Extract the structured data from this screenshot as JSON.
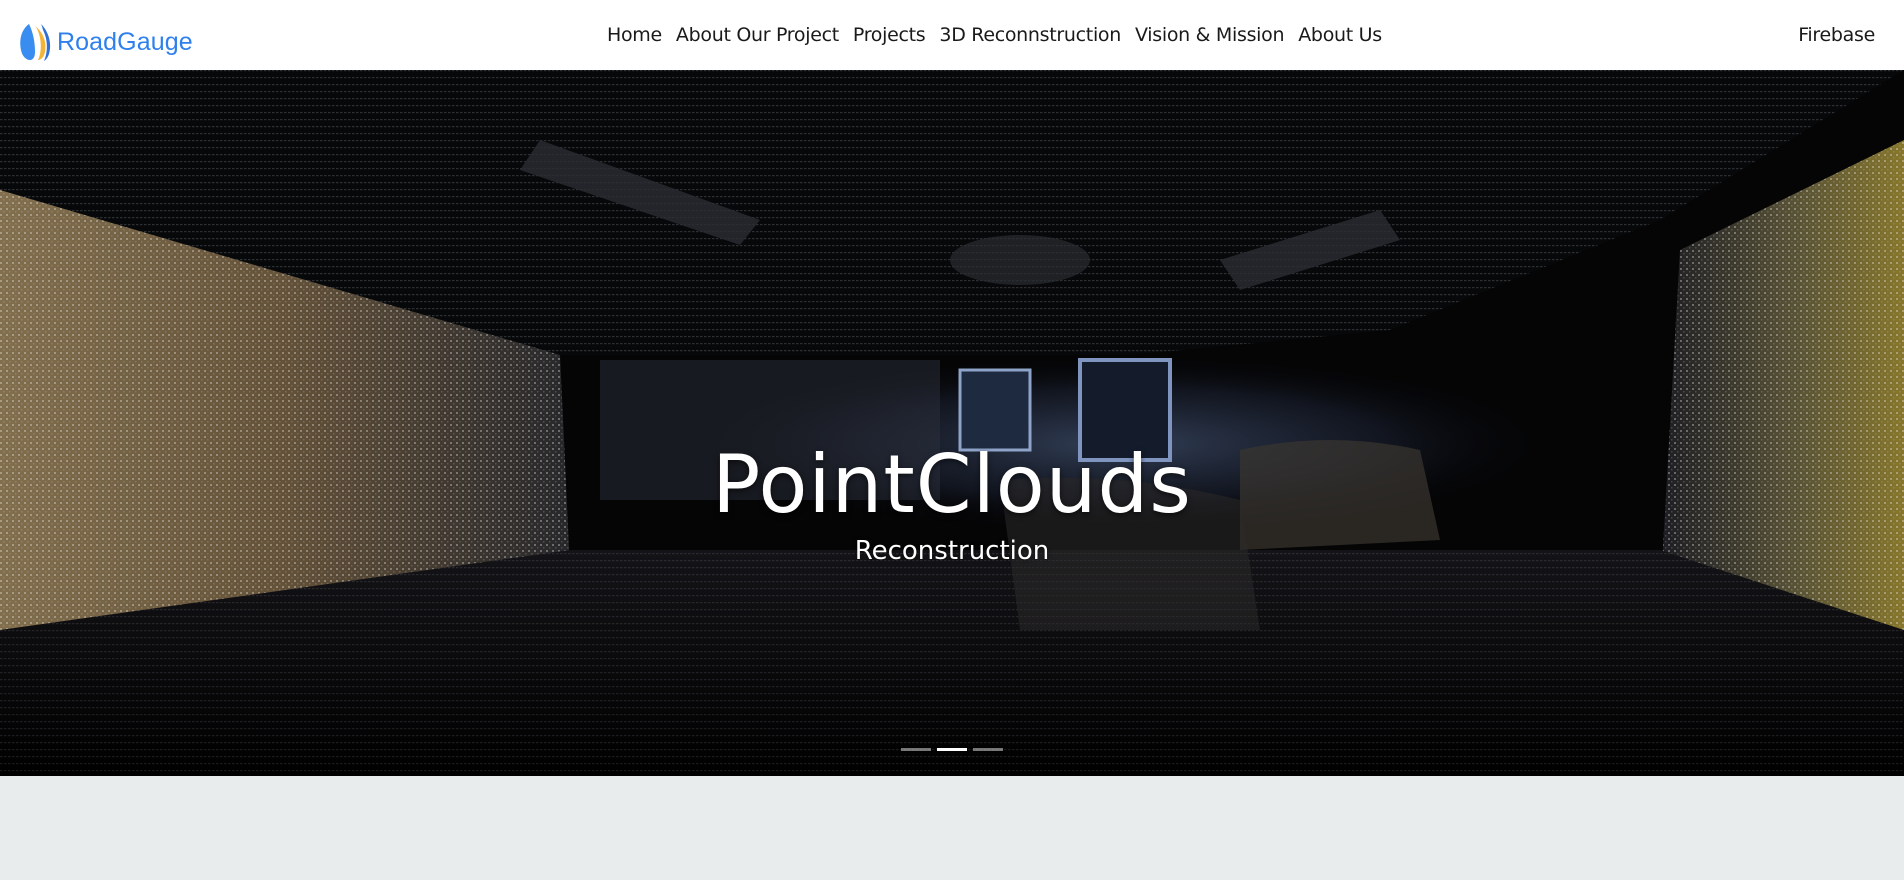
{
  "brand": {
    "name": "RoadGauge",
    "logo_icon": "roadgauge-logo-icon",
    "color": "#2f80ed"
  },
  "nav": {
    "links": [
      {
        "label": "Home"
      },
      {
        "label": "About Our Project"
      },
      {
        "label": "Projects"
      },
      {
        "label": "3D Reconnstruction"
      },
      {
        "label": "Vision & Mission"
      },
      {
        "label": "About Us"
      }
    ],
    "right_label": "Firebase"
  },
  "hero": {
    "title": "PointClouds",
    "subtitle": "Reconstruction",
    "slide_count": 3,
    "active_slide": 2
  },
  "colors": {
    "page_background": "#e9ecec",
    "navbar_background": "#ffffff",
    "hero_text": "#ffffff"
  }
}
